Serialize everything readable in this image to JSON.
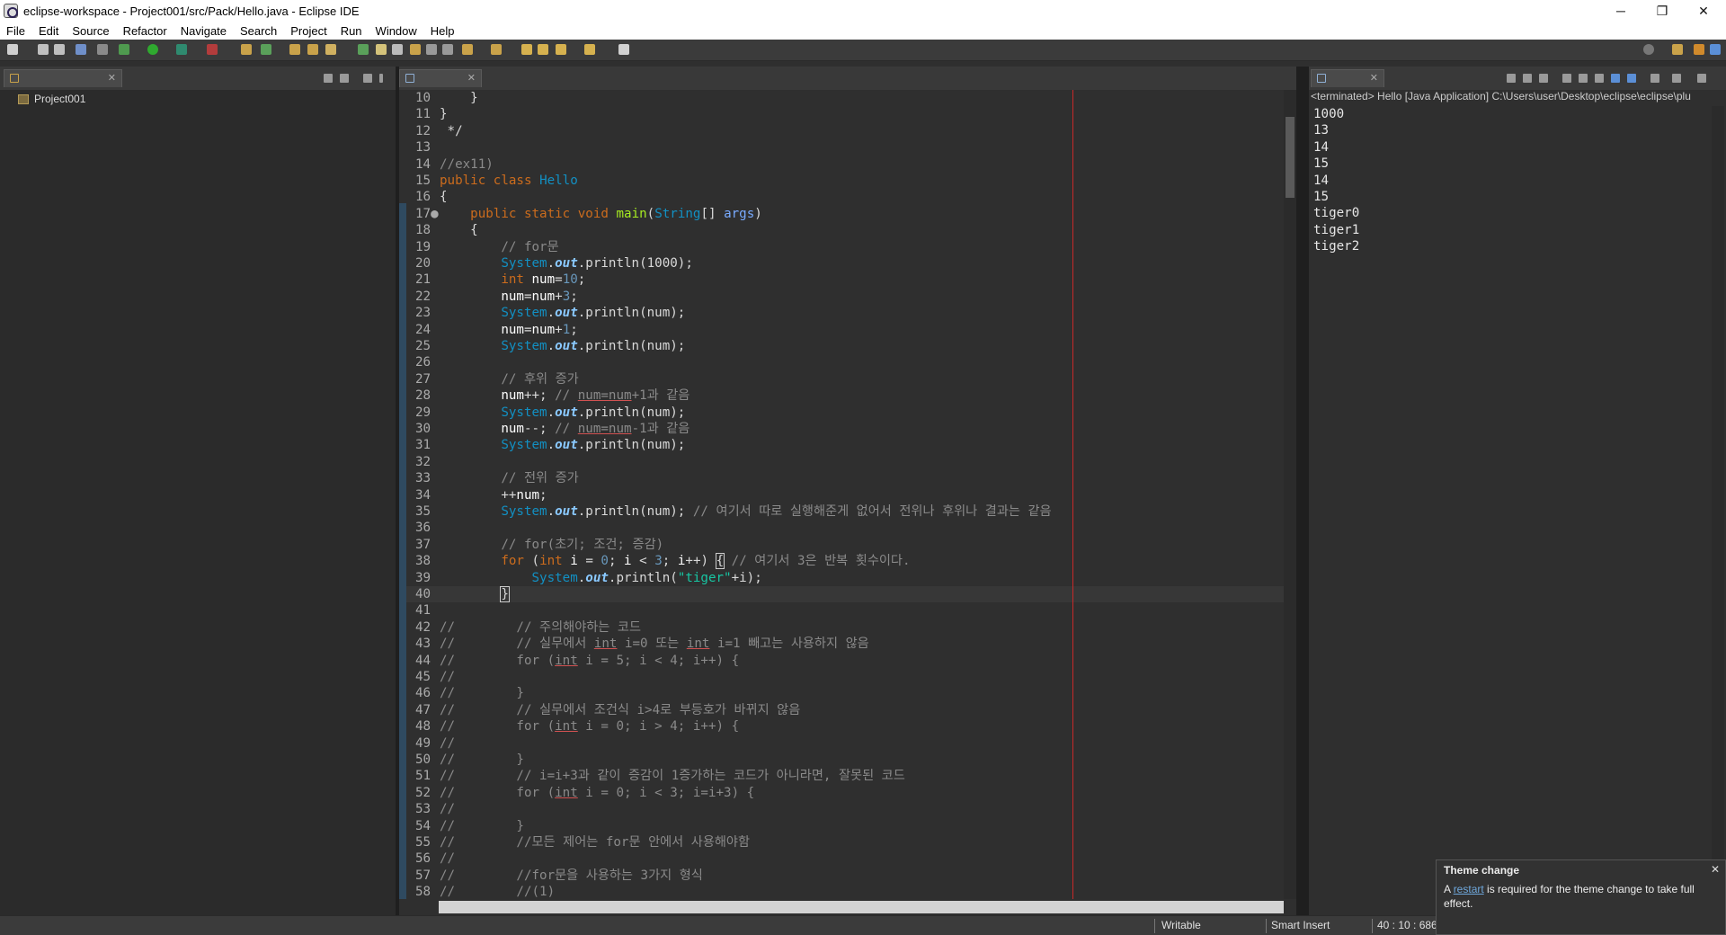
{
  "window": {
    "title": "eclipse-workspace - Project001/src/Pack/Hello.java - Eclipse IDE",
    "minimize": "─",
    "maximize": "❐",
    "close": "✕"
  },
  "menu": [
    "File",
    "Edit",
    "Source",
    "Refactor",
    "Navigate",
    "Search",
    "Project",
    "Run",
    "Window",
    "Help"
  ],
  "explorer": {
    "project": "Project001"
  },
  "editor": {
    "tab_close": "✕",
    "lines": [
      {
        "n": "10",
        "fold": "",
        "html": "    }"
      },
      {
        "n": "11",
        "fold": "",
        "html": "}"
      },
      {
        "n": "12",
        "fold": "",
        "html": " */"
      },
      {
        "n": "13",
        "fold": "",
        "html": ""
      },
      {
        "n": "14",
        "fold": "",
        "html": "<span class='c'>//ex11)</span>"
      },
      {
        "n": "15",
        "fold": "",
        "html": "<span class='k'>public</span> <span class='k'>class</span> <span class='t'>Hello</span>"
      },
      {
        "n": "16",
        "fold": "",
        "html": "{"
      },
      {
        "n": "17",
        "fold": "●",
        "html": "    <span class='k'>public</span> <span class='k'>static</span> <span class='k'>void</span> <span class='m'>main</span>(<span class='t'>String</span>[] <span class='p'>args</span>)"
      },
      {
        "n": "18",
        "fold": "",
        "html": "    {"
      },
      {
        "n": "19",
        "fold": "",
        "html": "        <span class='c'>// for문</span>"
      },
      {
        "n": "20",
        "fold": "",
        "html": "        <span class='t'>System</span>.<span class='f'>out</span>.println(1000);"
      },
      {
        "n": "21",
        "fold": "",
        "html": "        <span class='k'>int</span> <span class='txt'>num</span>=<span class='n'>10</span>;"
      },
      {
        "n": "22",
        "fold": "",
        "html": "        <span class='txt'>num</span>=<span class='txt'>num</span>+<span class='n'>3</span>;"
      },
      {
        "n": "23",
        "fold": "",
        "html": "        <span class='t'>System</span>.<span class='f'>out</span>.println(num);"
      },
      {
        "n": "24",
        "fold": "",
        "html": "        <span class='txt'>num</span>=<span class='txt'>num</span>+<span class='n'>1</span>;"
      },
      {
        "n": "25",
        "fold": "",
        "html": "        <span class='t'>System</span>.<span class='f'>out</span>.println(num);"
      },
      {
        "n": "26",
        "fold": "",
        "html": ""
      },
      {
        "n": "27",
        "fold": "",
        "html": "        <span class='c'>// 후위 증가</span>"
      },
      {
        "n": "28",
        "fold": "",
        "html": "        <span class='txt'>num</span>++; <span class='c'>// <span class='und'>num=num</span>+1과 같음</span>"
      },
      {
        "n": "29",
        "fold": "",
        "html": "        <span class='t'>System</span>.<span class='f'>out</span>.println(num);"
      },
      {
        "n": "30",
        "fold": "",
        "html": "        <span class='txt'>num</span>--; <span class='c'>// <span class='und'>num=num</span>-1과 같음</span>"
      },
      {
        "n": "31",
        "fold": "",
        "html": "        <span class='t'>System</span>.<span class='f'>out</span>.println(num);"
      },
      {
        "n": "32",
        "fold": "",
        "html": ""
      },
      {
        "n": "33",
        "fold": "",
        "html": "        <span class='c'>// 전위 증가</span>"
      },
      {
        "n": "34",
        "fold": "",
        "html": "        ++<span class='txt'>num</span>;"
      },
      {
        "n": "35",
        "fold": "",
        "html": "        <span class='t'>System</span>.<span class='f'>out</span>.println(num); <span class='c'>// 여기서 따로 실행해준게 없어서 전위나 후위나 결과는 같음</span>"
      },
      {
        "n": "36",
        "fold": "",
        "html": ""
      },
      {
        "n": "37",
        "fold": "",
        "html": "        <span class='c'>// for(초기; 조건; 증감)</span>"
      },
      {
        "n": "38",
        "fold": "",
        "html": "        <span class='k'>for</span> (<span class='k'>int</span> <span class='txt'>i</span> = <span class='n'>0</span>; <span class='txt'>i</span> &lt; <span class='n'>3</span>; <span class='txt'>i</span>++) <span class='boxed'>{</span> <span class='c'>// 여기서 3은 반복 횟수이다.</span>"
      },
      {
        "n": "39",
        "fold": "",
        "html": "            <span class='t'>System</span>.<span class='f'>out</span>.println(<span class='s'>\"tiger\"</span>+i);"
      },
      {
        "n": "40",
        "fold": "",
        "html": "        <span class='boxed'>}</span><span class='cursor'></span>"
      },
      {
        "n": "41",
        "fold": "",
        "html": ""
      },
      {
        "n": "42",
        "fold": "",
        "html": "<span class='c'>//        // 주의해야하는 코드</span>"
      },
      {
        "n": "43",
        "fold": "",
        "html": "<span class='c'>//        // 실무에서 <span class='und'>int</span> i=0 또는 <span class='und'>int</span> i=1 빼고는 사용하지 않음</span>"
      },
      {
        "n": "44",
        "fold": "",
        "html": "<span class='c'>//        for (<span class='und'>int</span> i = 5; i &lt; 4; i++) {</span>"
      },
      {
        "n": "45",
        "fold": "",
        "html": "<span class='c'>//</span>"
      },
      {
        "n": "46",
        "fold": "",
        "html": "<span class='c'>//        }</span>"
      },
      {
        "n": "47",
        "fold": "",
        "html": "<span class='c'>//        // 실무에서 조건식 i&gt;4로 부등호가 바뀌지 않음</span>"
      },
      {
        "n": "48",
        "fold": "",
        "html": "<span class='c'>//        for (<span class='und'>int</span> i = 0; i &gt; 4; i++) {</span>"
      },
      {
        "n": "49",
        "fold": "",
        "html": "<span class='c'>//</span>"
      },
      {
        "n": "50",
        "fold": "",
        "html": "<span class='c'>//        }</span>"
      },
      {
        "n": "51",
        "fold": "",
        "html": "<span class='c'>//        // i=i+3과 같이 증감이 1증가하는 코드가 아니라면, 잘못된 코드</span>"
      },
      {
        "n": "52",
        "fold": "",
        "html": "<span class='c'>//        for (<span class='und'>int</span> i = 0; i &lt; 3; i=i+3) {</span>"
      },
      {
        "n": "53",
        "fold": "",
        "html": "<span class='c'>//</span>"
      },
      {
        "n": "54",
        "fold": "",
        "html": "<span class='c'>//        }</span>"
      },
      {
        "n": "55",
        "fold": "",
        "html": "<span class='c'>//        //모든 제어는 for문 안에서 사용해야함</span>"
      },
      {
        "n": "56",
        "fold": "",
        "html": "<span class='c'>//</span>"
      },
      {
        "n": "57",
        "fold": "",
        "html": "<span class='c'>//        //for문을 사용하는 3가지 형식</span>"
      },
      {
        "n": "58",
        "fold": "",
        "html": "<span class='c'>//        //(1)</span>"
      }
    ]
  },
  "console": {
    "header": "<terminated> Hello [Java Application] C:\\Users\\user\\Desktop\\eclipse\\eclipse\\plu",
    "output": [
      "1000",
      "13",
      "14",
      "15",
      "14",
      "15",
      "tiger0",
      "tiger1",
      "tiger2"
    ]
  },
  "status": {
    "writable": "Writable",
    "insert_mode": "Smart Insert",
    "position": "40 : 10 : 686"
  },
  "popup": {
    "title": "Theme change",
    "close": "✕",
    "text_before": "A ",
    "link": "restart",
    "text_after": " is required for the theme change to take full effect."
  },
  "colors": {
    "editor_bg": "#2f2f2f",
    "keyword": "#cc6c1d",
    "type": "#1290c3",
    "comment": "#8a8a8a",
    "string": "#17c6a3"
  }
}
